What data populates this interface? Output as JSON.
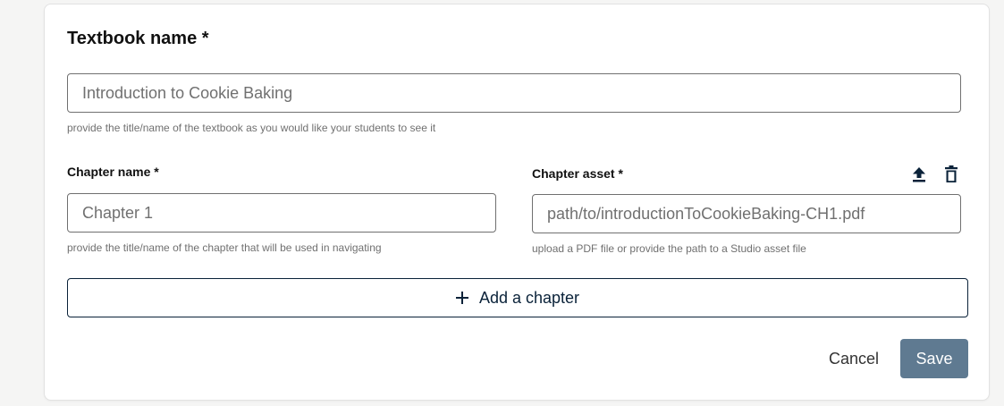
{
  "textbook": {
    "title": "Textbook name *",
    "placeholder": "Introduction to Cookie Baking",
    "help": "provide the title/name of the textbook as you would like your students to see it"
  },
  "chapter": {
    "name_label": "Chapter name *",
    "name_placeholder": "Chapter 1",
    "name_help": "provide the title/name of the chapter that will be used in navigating",
    "asset_label": "Chapter asset *",
    "asset_placeholder": "path/to/introductionToCookieBaking-CH1.pdf",
    "asset_help": "upload a PDF file or provide the path to a Studio asset file",
    "icons": [
      "upload-icon",
      "trash-icon"
    ]
  },
  "actions": {
    "add_chapter": "Add a chapter",
    "cancel": "Cancel",
    "save": "Save"
  },
  "colors": {
    "primary_dark": "#0a2239",
    "save_bg": "#5f7a91",
    "help_text": "#707070"
  }
}
